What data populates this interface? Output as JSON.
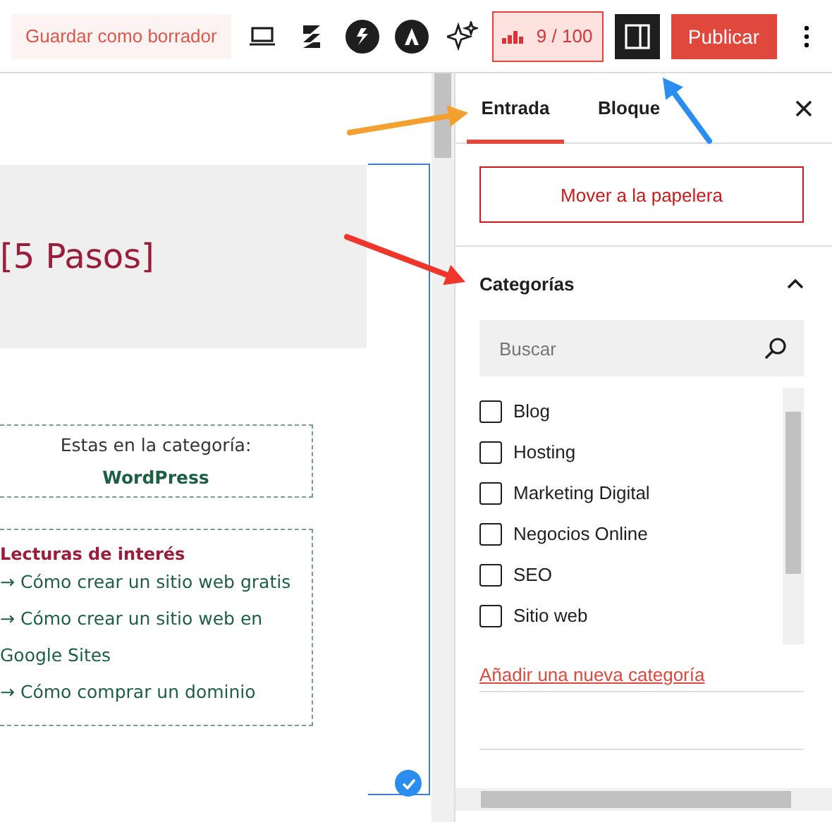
{
  "toolbar": {
    "save_draft": "Guardar como borrador",
    "score": "9 / 100",
    "publish": "Publicar"
  },
  "canvas": {
    "heading": "[5 Pasos]",
    "category_box": {
      "label": "Estas en la categoría:",
      "value": "WordPress"
    },
    "reading_box": {
      "title": "Lecturas de interés",
      "links": [
        {
          "arrow": "→",
          "text": "Cómo crear un sitio web gratis"
        },
        {
          "arrow": "→",
          "text": "Cómo crear un sitio web en Google Sites"
        },
        {
          "arrow": "→",
          "text": "Cómo comprar un dominio"
        }
      ]
    }
  },
  "sidebar": {
    "tabs": [
      {
        "label": "Entrada",
        "selected": true
      },
      {
        "label": "Bloque",
        "selected": false
      }
    ],
    "trash_button": "Mover a la papelera",
    "categories": {
      "title": "Categorías",
      "expanded": true,
      "search": {
        "placeholder": "Buscar"
      },
      "items": [
        {
          "label": "Blog",
          "checked": false
        },
        {
          "label": "Hosting",
          "checked": false
        },
        {
          "label": "Marketing Digital",
          "checked": false
        },
        {
          "label": "Negocios Online",
          "checked": false
        },
        {
          "label": "SEO",
          "checked": false
        },
        {
          "label": "Sitio web",
          "checked": false
        }
      ],
      "add_link": "Añadir una nueva categoría"
    }
  }
}
